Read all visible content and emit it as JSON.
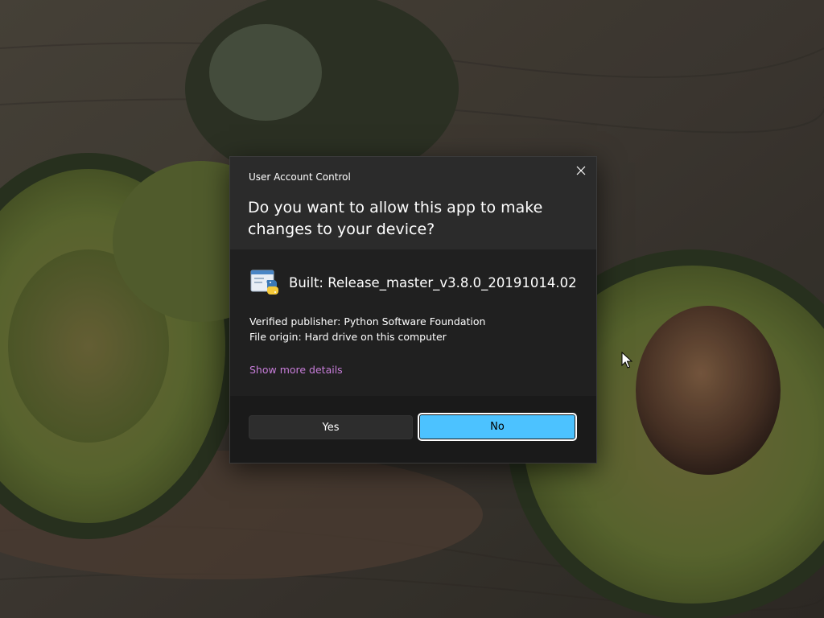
{
  "dialog": {
    "title": "User Account Control",
    "question": "Do you want to allow this app to make changes to your device?",
    "app_name": "Built: Release_master_v3.8.0_20191014.02",
    "app_icon": "python-icon",
    "publisher": "Verified publisher: Python Software Foundation",
    "file_origin": "File origin: Hard drive on this computer",
    "show_more_label": "Show more details",
    "yes_label": "Yes",
    "no_label": "No",
    "close_icon": "close-icon"
  },
  "colors": {
    "accent": "#4cc2ff",
    "link": "#c77dd9",
    "dialog_header": "#2b2b2b",
    "dialog_body": "#202020",
    "dialog_footer": "#1a1a1a"
  },
  "wallpaper": {
    "subject": "avocado-halves-wallpaper"
  }
}
